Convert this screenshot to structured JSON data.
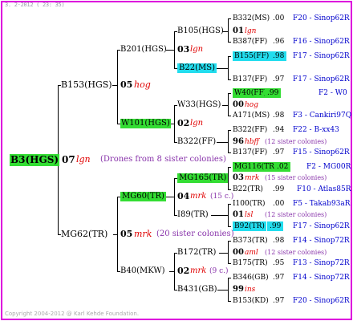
{
  "header": "3. 2-2012 ( 23: 35)",
  "footer": "Copyright 2004-2012 @ Karl Kehde Foundation.",
  "root": {
    "id": "B3(HGS)",
    "year": "07",
    "breeder": "lgn",
    "note": "(Drones from 8 sister colonies)"
  },
  "gen1": [
    {
      "id": "B153(HGS)",
      "year": "05",
      "breeder": "hog"
    },
    {
      "id": "MG62(TR)",
      "year": "05",
      "breeder": "mrk",
      "note": "(20 sister colonies)"
    }
  ],
  "gen2": [
    {
      "id": "B201(HGS)",
      "year": "03",
      "breeder": "lgn"
    },
    {
      "id": "W101(HGS)",
      "year": "02",
      "breeder": "lgn"
    },
    {
      "id": "MG60(TR)",
      "year": "04",
      "breeder": "mrk",
      "note": "(15 c.)"
    },
    {
      "id": "B40(MKW)",
      "year": "02",
      "breeder": "mrk",
      "note": "(9 c.)"
    }
  ],
  "gen3": [
    {
      "id": "B105(HGS)",
      "year": "01",
      "breeder": "lgn"
    },
    {
      "id": "B22(MS)"
    },
    {
      "id": "W33(HGS)",
      "year": "00",
      "breeder": "hog"
    },
    {
      "id": "B322(FF)",
      "year": "96",
      "breeder": "hbff",
      "note": "(12 sister colonies)"
    },
    {
      "id": "MG165(TR)",
      "year": "03",
      "breeder": "mrk",
      "note": "(15 sister colonies)"
    },
    {
      "id": "I89(TR)",
      "year": "01",
      "breeder": "lsl",
      "note": "(12 sister colonies)"
    },
    {
      "id": "B172(TR)",
      "year": "00",
      "breeder": "aml",
      "note": "(12 sister colonies)"
    },
    {
      "id": "B431(GB)",
      "year": "99",
      "breeder": "ins"
    }
  ],
  "gen4": [
    {
      "id": "B332(MS)",
      "year": ".00",
      "code": "F20 - Sinop62R"
    },
    {
      "id": "B387(FF)",
      "year": ".96",
      "code": "F16 - Sinop62R"
    },
    {
      "id": "B155(FF)",
      "year": ".98",
      "code": "F17 - Sinop62R"
    },
    {
      "id": "B137(FF)",
      "year": ".97",
      "code": "F17 - Sinop62R"
    },
    {
      "id": "W40(FF)",
      "year": ".99",
      "code": "F2 - W0"
    },
    {
      "id": "A171(MS)",
      "year": ".98",
      "code": "F3 - Cankiri97Q"
    },
    {
      "id": "B322(FF)",
      "year": ".94",
      "code": "F22 - B-xx43"
    },
    {
      "id": "B137(FF)",
      "year": ".97",
      "code": "F15 - Sinop62R"
    },
    {
      "id": "MG116(TR)",
      "year": ".02",
      "code": "F2 - MG00R"
    },
    {
      "id": "B22(TR)",
      "year": ".99",
      "code": "F10 - Atlas85R"
    },
    {
      "id": "I100(TR)",
      "year": ".00",
      "code": "F5 - Takab93aR"
    },
    {
      "id": "B92(TR)",
      "year": ".99",
      "code": "F17 - Sinop62R"
    },
    {
      "id": "B373(TR)",
      "year": ".98",
      "code": "F14 - Sinop72R"
    },
    {
      "id": "B175(TR)",
      "year": ".95",
      "code": "F13 - Sinop72R"
    },
    {
      "id": "B346(GB)",
      "year": ".97",
      "code": "F14 - Sinop72R"
    },
    {
      "id": "B153(KD)",
      "year": ".97",
      "code": "F20 - Sinop62R"
    }
  ],
  "colors": {
    "frame": "#dd00dd",
    "green": "#33dd33",
    "cyan": "#22ddee",
    "red": "#e00000",
    "blue": "#0000cc",
    "purple": "#8833aa"
  }
}
